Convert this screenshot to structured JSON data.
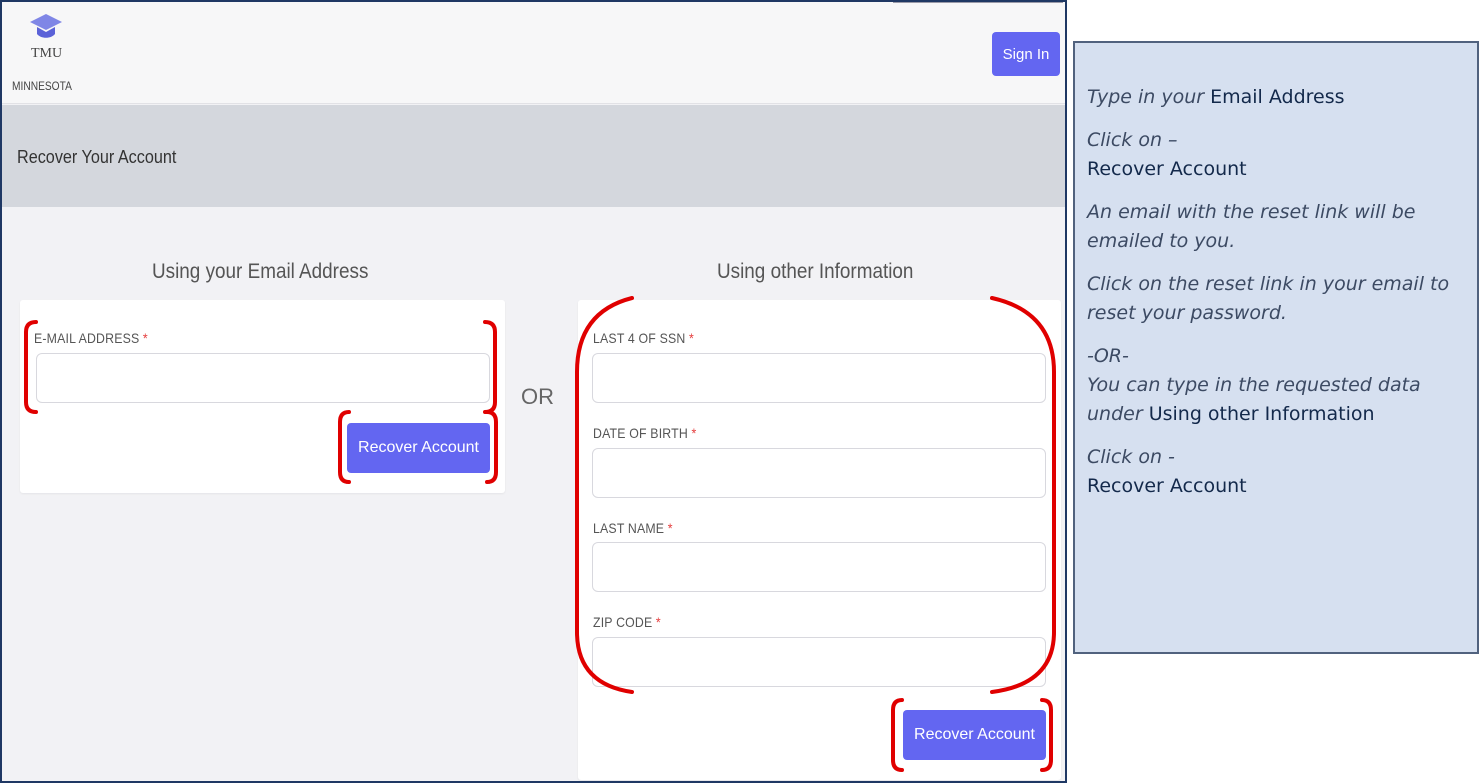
{
  "header": {
    "logo_text": "TMU",
    "logo_subtext": "MINNESOTA",
    "signin_label": "Sign In"
  },
  "banner": {
    "title": "Recover Your Account"
  },
  "email_section": {
    "heading": "Using your Email Address",
    "email_label": "E-MAIL ADDRESS",
    "email_value": "",
    "button_label": "Recover Account"
  },
  "divider": {
    "or_label": "OR"
  },
  "other_section": {
    "heading": "Using other Information",
    "fields": [
      {
        "label": "LAST 4 OF SSN",
        "value": ""
      },
      {
        "label": "DATE OF BIRTH",
        "value": ""
      },
      {
        "label": "LAST NAME",
        "value": ""
      },
      {
        "label": "ZIP CODE",
        "value": ""
      }
    ],
    "button_label": "Recover Account"
  },
  "required_marker": "*",
  "callout": {
    "p1_italic": "Type in your ",
    "p1_plain": "Email Address",
    "p2_italic": "Click on –",
    "p2_plain": "Recover Account",
    "p3": "An email with the reset link will be emailed to you.",
    "p4": "Click on the reset link in your email to reset your password.",
    "p5_or": "-OR-",
    "p5_italic": "You can type in the requested data under ",
    "p5_plain": "Using other Information",
    "p6_italic": "Click on -",
    "p6_plain": "Recover Account"
  },
  "colors": {
    "accent": "#6366f1",
    "highlight": "#e00000",
    "callout_bg": "#d6e0f0",
    "frame_border": "#1f3864"
  }
}
